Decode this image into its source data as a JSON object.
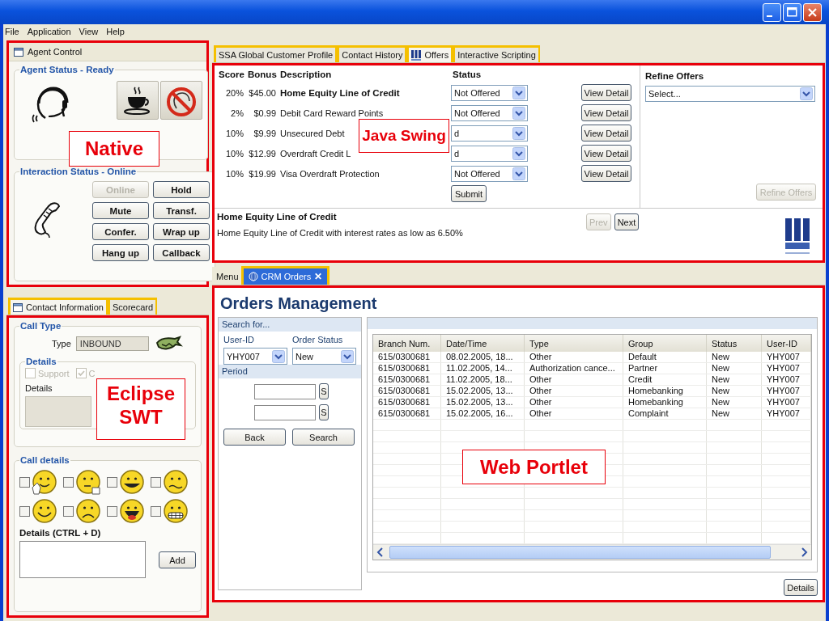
{
  "window": {
    "menu": [
      "File",
      "Application",
      "View",
      "Help"
    ]
  },
  "callouts": [
    "Native",
    "Java Swing",
    "Eclipse SWT",
    "Web Portlet"
  ],
  "agent_control": {
    "title": "Agent Control",
    "status_title": "Agent Status - Ready",
    "status_buttons": [
      {
        "kind": "coffee"
      },
      {
        "kind": "no_call"
      }
    ],
    "interaction_title": "Interaction Status - Online",
    "buttons": [
      {
        "label": "Online",
        "disabled": true
      },
      {
        "label": "Hold",
        "disabled": false
      },
      {
        "label": "Mute",
        "disabled": false
      },
      {
        "label": "Transf.",
        "disabled": false
      },
      {
        "label": "Confer.",
        "disabled": false
      },
      {
        "label": "Wrap up",
        "disabled": false
      },
      {
        "label": "Hang up",
        "disabled": false
      },
      {
        "label": "Callback",
        "disabled": false
      }
    ]
  },
  "contact_tabs": [
    {
      "label": "Contact Information",
      "selected": true,
      "kind": "icon"
    },
    {
      "label": "Scorecard",
      "selected": false,
      "kind": "plain"
    }
  ],
  "call_type": {
    "title": "Call Type",
    "type_label": "Type",
    "type_value": "INBOUND",
    "details_title": "Details",
    "checkboxes": [
      {
        "label": "Support",
        "checked": false,
        "disabled": true
      },
      {
        "label": "C",
        "checked": true,
        "disabled": true
      }
    ],
    "details_label": "Details"
  },
  "call_details": {
    "title": "Call details",
    "options": [
      {
        "kind": "waving",
        "checked": false
      },
      {
        "kind": "thinking",
        "checked": false
      },
      {
        "kind": "grinning",
        "checked": false
      },
      {
        "kind": "worried",
        "checked": false
      },
      {
        "kind": "smiling",
        "checked": false
      },
      {
        "kind": "sad",
        "checked": false
      },
      {
        "kind": "laughing",
        "checked": false
      },
      {
        "kind": "grimacing",
        "checked": false
      }
    ],
    "notes_label": "Details (CTRL + D)",
    "add_button": "Add"
  },
  "offer_tabs": [
    {
      "label": "SSA Global Customer Profile",
      "selected": false,
      "kind": "plain"
    },
    {
      "label": "Contact History",
      "selected": false,
      "kind": "plain"
    },
    {
      "label": "Offers",
      "selected": true,
      "kind": "icon"
    },
    {
      "label": "Interactive Scripting",
      "selected": false,
      "kind": "plain"
    }
  ],
  "offers": {
    "columns": [
      "Score",
      "Bonus",
      "Description",
      "Status"
    ],
    "rows": [
      {
        "score": "20%",
        "bonus": "$45.00",
        "description": "Home Equity Line of Credit",
        "status": "Not Offered",
        "selected": true,
        "action": "View Detail"
      },
      {
        "score": "2%",
        "bonus": "$0.99",
        "description": "Debit Card Reward Points",
        "status": "Not Offered",
        "selected": false,
        "action": "View Detail"
      },
      {
        "score": "10%",
        "bonus": "$9.99",
        "description": "Unsecured Debt",
        "status": "d",
        "selected": false,
        "action": "View Detail"
      },
      {
        "score": "10%",
        "bonus": "$12.99",
        "description": "Overdraft Credit L",
        "status": "d",
        "selected": false,
        "action": "View Detail"
      },
      {
        "score": "10%",
        "bonus": "$19.99",
        "description": "Visa Overdraft Protection",
        "status": "Not Offered",
        "selected": false,
        "action": "View Detail"
      }
    ],
    "submit": "Submit",
    "refine": {
      "title": "Refine Offers",
      "select": "Select...",
      "button": "Refine Offers",
      "button_disabled": true
    },
    "detail": {
      "title": "Home Equity Line of Credit",
      "text": "Home Equity Line of Credit with interest rates as low as 6.50%"
    },
    "prev": {
      "label": "Prev",
      "disabled": true
    },
    "next": {
      "label": "Next",
      "disabled": false
    }
  },
  "portal_tabs": [
    {
      "label": "Menu",
      "selected": false,
      "kind": "plain"
    },
    {
      "label": "CRM Orders",
      "selected": true,
      "kind": "icon",
      "close": "✕"
    }
  ],
  "orders": {
    "title": "Orders Management",
    "search": {
      "title": "Search for...",
      "user_id_label": "User-ID",
      "user_id": "YHY007",
      "status_label": "Order Status",
      "status": "New",
      "period_label": "Period",
      "date_buttons": [
        "S",
        "S"
      ],
      "back": "Back",
      "search": "Search"
    },
    "table": {
      "columns": [
        "Branch Num.",
        "Date/Time",
        "Type",
        "Group",
        "Status",
        "User-ID"
      ],
      "rows": [
        [
          "615/0300681",
          "08.02.2005, 18...",
          "Other",
          "Default",
          "New",
          "YHY007"
        ],
        [
          "615/0300681",
          "11.02.2005, 14...",
          "Authorization cance...",
          "Partner",
          "New",
          "YHY007"
        ],
        [
          "615/0300681",
          "11.02.2005, 18...",
          "Other",
          "Credit",
          "New",
          "YHY007"
        ],
        [
          "615/0300681",
          "15.02.2005, 13...",
          "Other",
          "Homebanking",
          "New",
          "YHY007"
        ],
        [
          "615/0300681",
          "15.02.2005, 13...",
          "Other",
          "Homebanking",
          "New",
          "YHY007"
        ],
        [
          "615/0300681",
          "15.02.2005, 16...",
          "Other",
          "Complaint",
          "New",
          "YHY007"
        ]
      ]
    },
    "details_button": "Details"
  }
}
